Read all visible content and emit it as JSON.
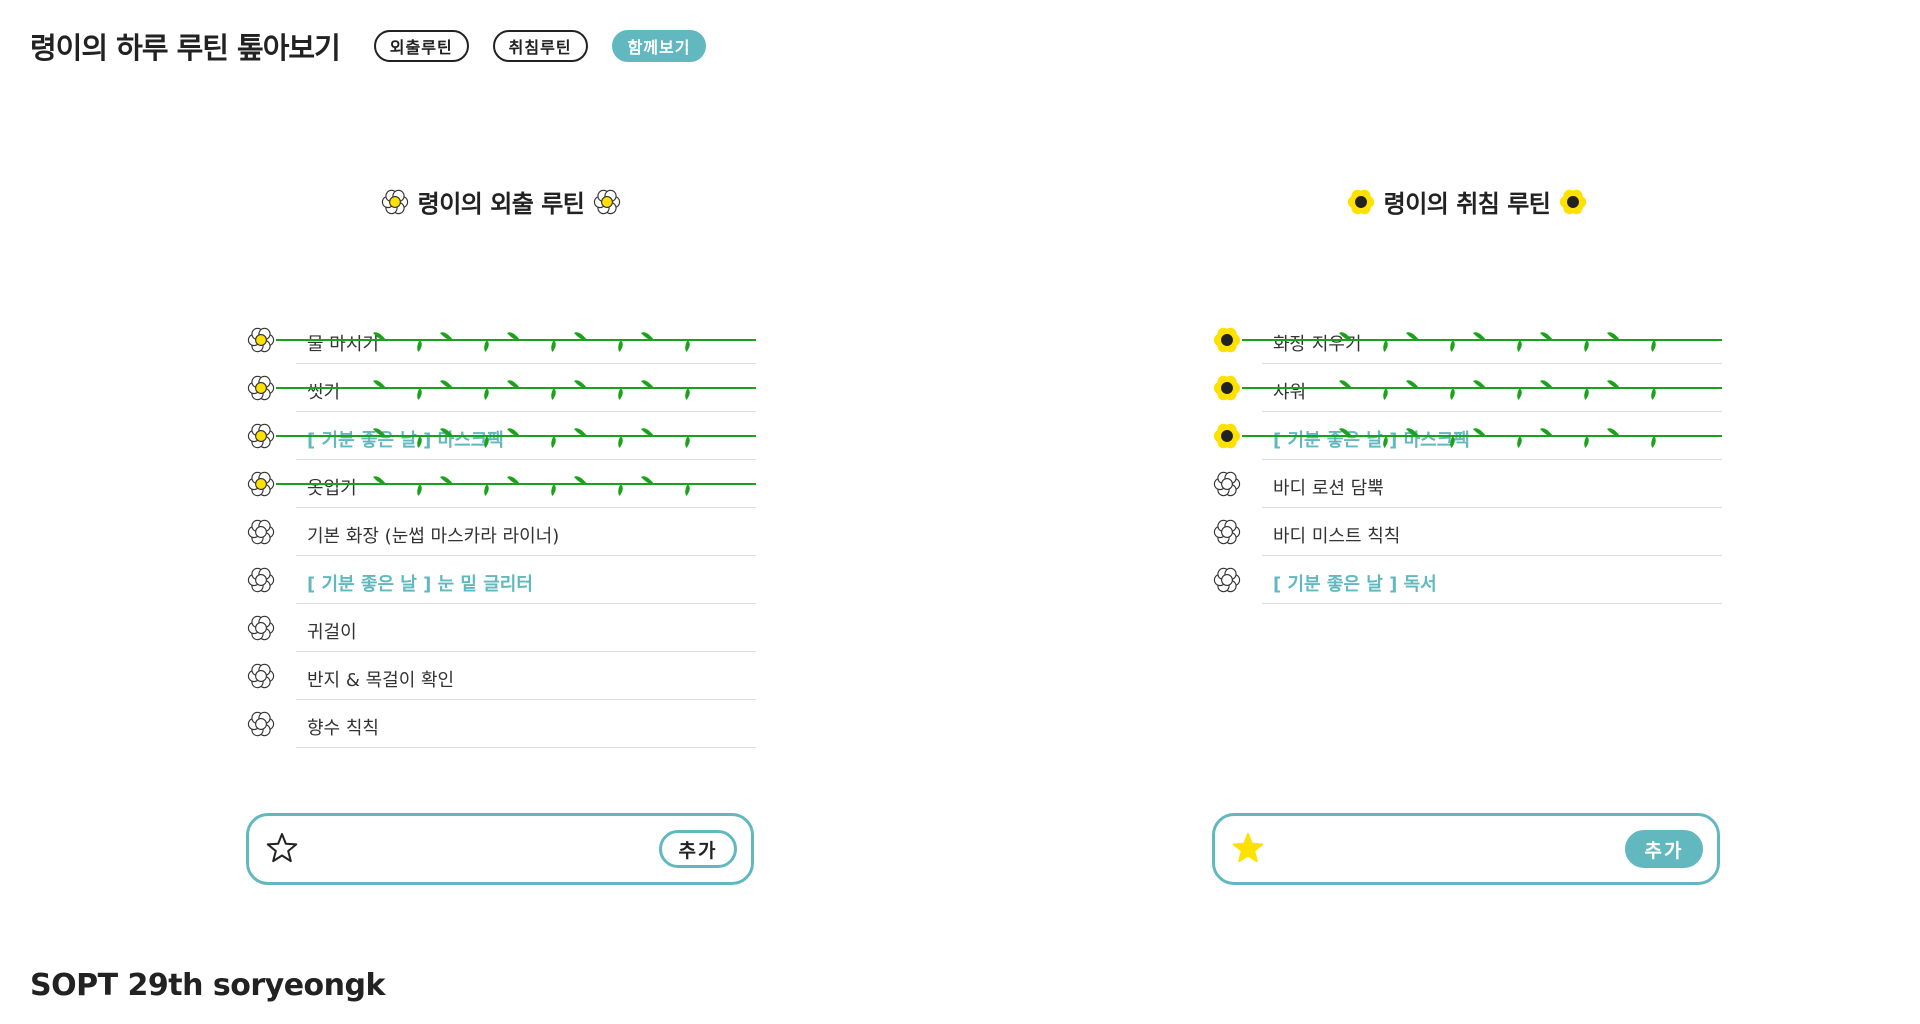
{
  "header": {
    "title": "령이의 하루 루틴 톺아보기",
    "tabs": [
      {
        "label": "외출루틴",
        "active": false
      },
      {
        "label": "취침루틴",
        "active": false
      },
      {
        "label": "함께보기",
        "active": true
      }
    ]
  },
  "panels": [
    {
      "title": "령이의 외출 루틴",
      "flower_style": "yellow-center",
      "items": [
        {
          "label": "물 마시기",
          "done": true,
          "special": false
        },
        {
          "label": "씻기",
          "done": true,
          "special": false
        },
        {
          "label": "[ 기분 좋은 날 ] 마스크팩",
          "done": true,
          "special": true
        },
        {
          "label": "옷입기",
          "done": true,
          "special": false
        },
        {
          "label": "기본 화장 (눈썹 마스카라 라이너)",
          "done": false,
          "special": false
        },
        {
          "label": "[ 기분 좋은 날 ] 눈 밑 글리터",
          "done": false,
          "special": true
        },
        {
          "label": "귀걸이",
          "done": false,
          "special": false
        },
        {
          "label": "반지 & 목걸이 확인",
          "done": false,
          "special": false
        },
        {
          "label": "향수 칙칙",
          "done": false,
          "special": false
        }
      ],
      "input": {
        "value": "",
        "placeholder": ""
      },
      "add_button": "추가",
      "star_filled": false
    },
    {
      "title": "령이의 취침 루틴",
      "flower_style": "sunflower",
      "items": [
        {
          "label": "화장 지우기",
          "done": true,
          "special": false
        },
        {
          "label": "샤워",
          "done": true,
          "special": false
        },
        {
          "label": "[ 기분 좋은 날 ] 마스크팩",
          "done": true,
          "special": true
        },
        {
          "label": "바디 로션 담뿍",
          "done": false,
          "special": false
        },
        {
          "label": "바디 미스트 칙칙",
          "done": false,
          "special": false
        },
        {
          "label": "[ 기분 좋은 날 ] 독서",
          "done": false,
          "special": true
        }
      ],
      "input": {
        "value": "",
        "placeholder": ""
      },
      "add_button": "추가",
      "star_filled": true
    }
  ],
  "footer": "SOPT 29th soryeongk",
  "colors": {
    "accent": "#62b8bf",
    "vine": "#1aa31a",
    "petal_yellow": "#ffe100",
    "sunflower_center": "#222222"
  },
  "icons": {
    "outing_flower": "daisy-yellow-center-icon",
    "bedtime_flower": "sunflower-icon",
    "empty_flower": "flower-outline-icon",
    "star_outline": "star-outline-icon",
    "star_filled": "star-filled-icon"
  }
}
